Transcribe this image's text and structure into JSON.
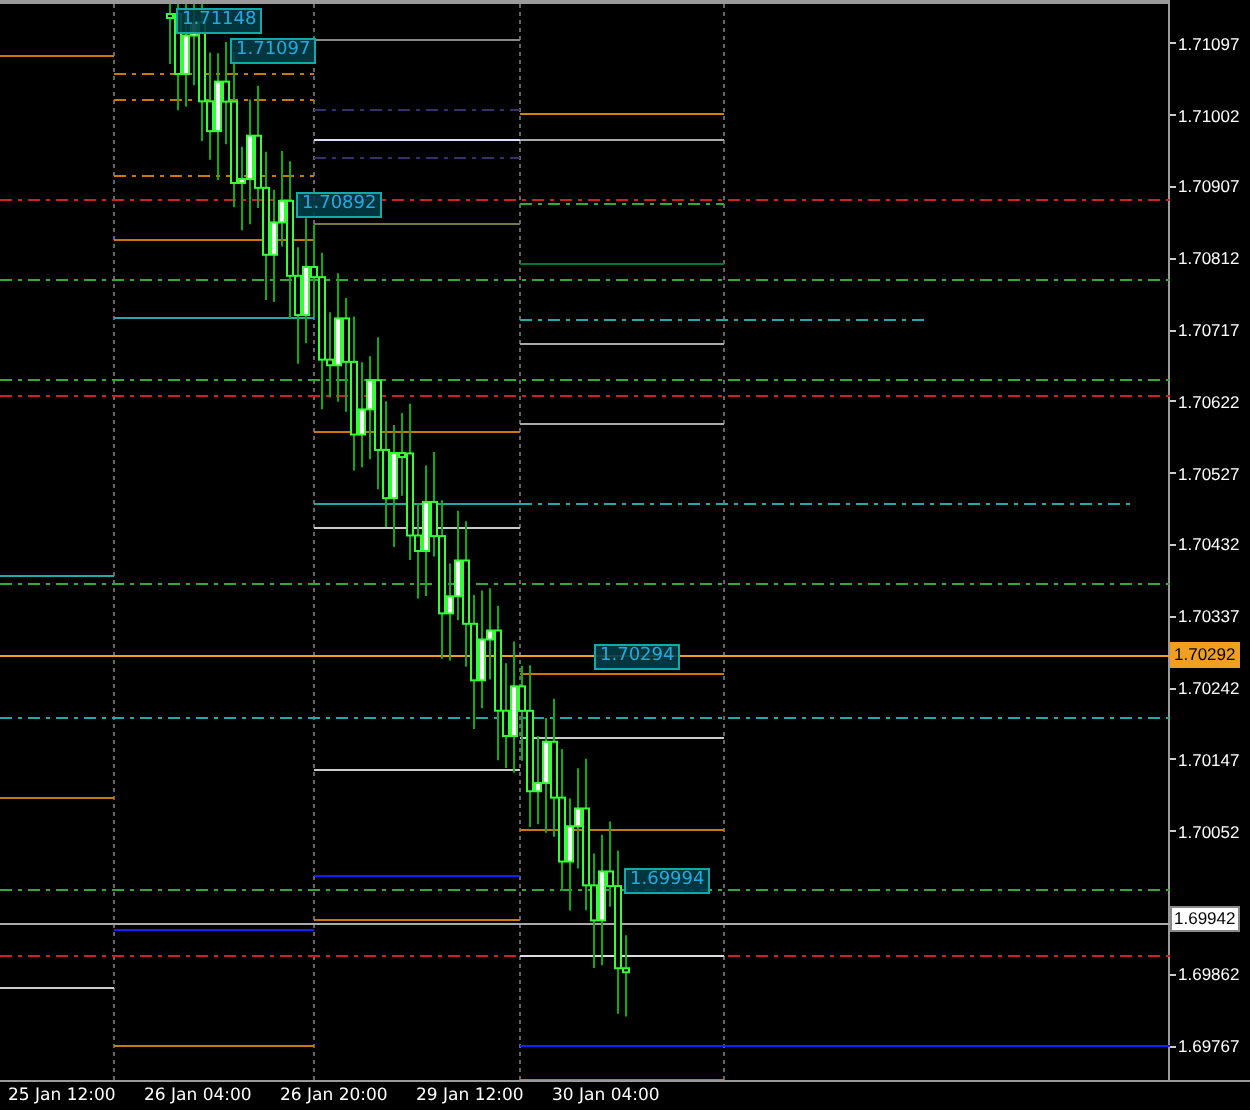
{
  "chart_tags": [
    {
      "label": "1.71148"
    },
    {
      "label": "1.71097"
    },
    {
      "label": "1.70892"
    },
    {
      "label": "1.70294"
    },
    {
      "label": "1.69994"
    }
  ],
  "price_axis": [
    "1.71097",
    "1.71002",
    "1.70907",
    "1.70812",
    "1.70717",
    "1.70622",
    "1.70527",
    "1.70432",
    "1.70337",
    "1.70242",
    "1.70147",
    "1.70052",
    "1.69862",
    "1.69767"
  ],
  "price_badges": [
    {
      "label": "1.70292",
      "kind": "alert"
    },
    {
      "label": "1.69942",
      "kind": "bid"
    }
  ],
  "time_axis": [
    "25 Jan 12:00",
    "26 Jan 04:00",
    "26 Jan 20:00",
    "29 Jan 12:00",
    "30 Jan 04:00"
  ]
}
